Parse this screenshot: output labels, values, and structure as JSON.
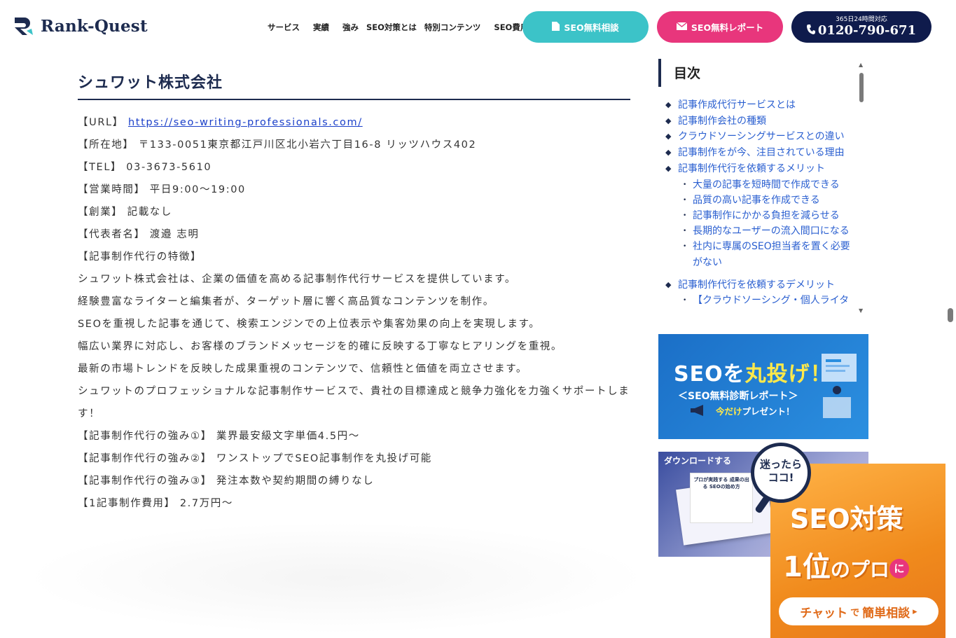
{
  "header": {
    "logo_text": "Rank-Quest",
    "nav": [
      "サービス",
      "実績",
      "強み",
      "SEO対策とは",
      "特別コンテンツ",
      "SEO費用"
    ],
    "consult_label": "SEO無料相談",
    "report_label": "SEO無料レポート",
    "tel_sub": "365日24時間対応",
    "tel_number": "0120-790-671"
  },
  "article": {
    "title": "シュワット株式会社",
    "url_label": "【URL】",
    "url": "https://seo-writing-professionals.com/",
    "lines": [
      "【所在地】 〒133-0051東京都江戸川区北小岩六丁目16-8 リッツハウス402",
      "【TEL】 03-3673-5610",
      "【営業時間】 平日9:00〜19:00",
      "【創業】 記載なし",
      "【代表者名】 渡邉 志明",
      "【記事制作代行の特徴】",
      "シュワット株式会社は、企業の価値を高める記事制作代行サービスを提供しています。",
      "経験豊富なライターと編集者が、ターゲット層に響く高品質なコンテンツを制作。",
      "SEOを重視した記事を通じて、検索エンジンでの上位表示や集客効果の向上を実現します。",
      "幅広い業界に対応し、お客様のブランドメッセージを的確に反映する丁寧なヒアリングを重視。",
      "最新の市場トレンドを反映した成果重視のコンテンツで、信頼性と価値を両立させます。",
      "シュワットのプロフェッショナルな記事制作サービスで、貴社の目標達成と競争力強化を力強くサポートします！",
      "【記事制作代行の強み①】 業界最安級文字単価4.5円〜",
      "【記事制作代行の強み②】 ワンストップでSEO記事制作を丸投げ可能",
      "【記事制作代行の強み③】 発注本数や契約期間の縛りなし",
      "【1記事制作費用】 2.7万円〜"
    ]
  },
  "toc": {
    "heading": "目次",
    "items": [
      {
        "label": "記事作成代行サービスとは",
        "level": 1
      },
      {
        "label": "記事制作会社の種類",
        "level": 1
      },
      {
        "label": "クラウドソーシングサービスとの違い",
        "level": 1
      },
      {
        "label": "記事制作をが今、注目されている理由",
        "level": 1
      },
      {
        "label": "記事制作代行を依頼するメリット",
        "level": 1
      },
      {
        "label": "大量の記事を短時間で作成できる",
        "level": 2
      },
      {
        "label": "品質の高い記事を作成できる",
        "level": 2
      },
      {
        "label": "記事制作にかかる負担を減らせる",
        "level": 2
      },
      {
        "label": "長期的なユーザーの流入間口になる",
        "level": 2
      },
      {
        "label": "社内に専属のSEO担当者を置く必要がない",
        "level": 2
      },
      {
        "label": "記事制作代行を依頼するデメリット",
        "level": 1
      },
      {
        "label": "【クラウドソーシング・個人ライターの場合】",
        "level": 2
      }
    ]
  },
  "banner_seo": {
    "title_a": "SEOを",
    "title_b": "丸投げ！",
    "sub": "＜SEO無料診断レポート＞",
    "sub2_a": "今だけ",
    "sub2_b": "プレゼント！"
  },
  "banner_download": {
    "tag": "ダウンロードする",
    "book_text": "プロが実践する 成果の出る SEOの始め方"
  },
  "chat": {
    "bubble": "迷ったら ココ!",
    "line1": "SEO対策",
    "line2_big": "1位",
    "line2_small": "のプロ",
    "line2_ni": "に",
    "button_a": "チャット",
    "button_b": "で",
    "button_c": "簡単相談",
    "button_arrow": "▸"
  },
  "colors": {
    "navy": "#1d2b4f",
    "teal": "#3cc3c8",
    "pink": "#e8367c",
    "link": "#2a5fd0",
    "orange": "#f08a1c"
  }
}
